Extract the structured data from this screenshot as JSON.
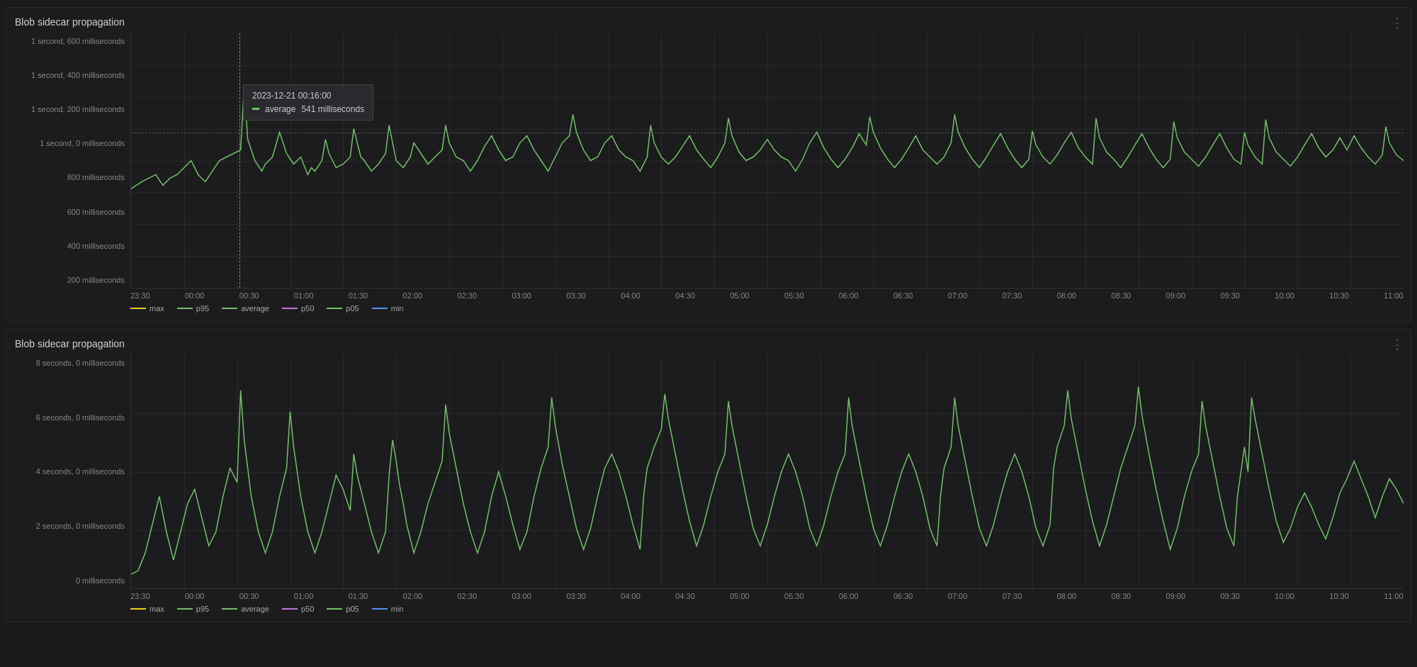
{
  "charts": [
    {
      "id": "chart1",
      "title": "Blob sidecar propagation",
      "yLabels": [
        "1 second, 600 milliseconds",
        "1 second, 400 milliseconds",
        "1 second, 200 milliseconds",
        "1 second, 0 milliseconds",
        "800 milliseconds",
        "600 milliseconds",
        "400 milliseconds",
        "200 milliseconds"
      ],
      "xLabels": [
        "23:30",
        "00:00",
        "00:30",
        "01:00",
        "01:30",
        "02:00",
        "02:30",
        "03:00",
        "03:30",
        "04:00",
        "04:30",
        "05:00",
        "05:30",
        "06:00",
        "06:30",
        "07:00",
        "07:30",
        "08:00",
        "08:30",
        "09:00",
        "09:30",
        "10:00",
        "10:30",
        "11:00"
      ],
      "tooltip": {
        "visible": true,
        "title": "2023-12-21 00:16:00",
        "series": "average",
        "value": "541 milliseconds",
        "color": "#73bf69"
      },
      "legend": [
        {
          "label": "max",
          "color": "#f2cc0c"
        },
        {
          "label": "p95",
          "color": "#73bf69"
        },
        {
          "label": "average",
          "color": "#73bf69"
        },
        {
          "label": "p50",
          "color": "#b877d9"
        },
        {
          "label": "p05",
          "color": "#73bf69"
        },
        {
          "label": "min",
          "color": "#5794f2"
        }
      ],
      "dashedLineY": 62
    },
    {
      "id": "chart2",
      "title": "Blob sidecar propagation",
      "yLabels": [
        "8 seconds, 0 milliseconds",
        "6 seconds, 0 milliseconds",
        "4 seconds, 0 milliseconds",
        "2 seconds, 0 milliseconds",
        "0 milliseconds"
      ],
      "xLabels": [
        "23:30",
        "00:00",
        "00:30",
        "01:00",
        "01:30",
        "02:00",
        "02:30",
        "03:00",
        "03:30",
        "04:00",
        "04:30",
        "05:00",
        "05:30",
        "06:00",
        "06:30",
        "07:00",
        "07:30",
        "08:00",
        "08:30",
        "09:00",
        "09:30",
        "10:00",
        "10:30",
        "11:00"
      ],
      "legend": [
        {
          "label": "max",
          "color": "#f2cc0c"
        },
        {
          "label": "p95",
          "color": "#73bf69"
        },
        {
          "label": "average",
          "color": "#73bf69"
        },
        {
          "label": "p50",
          "color": "#b877d9"
        },
        {
          "label": "p05",
          "color": "#73bf69"
        },
        {
          "label": "min",
          "color": "#5794f2"
        }
      ]
    }
  ],
  "icons": {
    "menu": "⋮"
  }
}
